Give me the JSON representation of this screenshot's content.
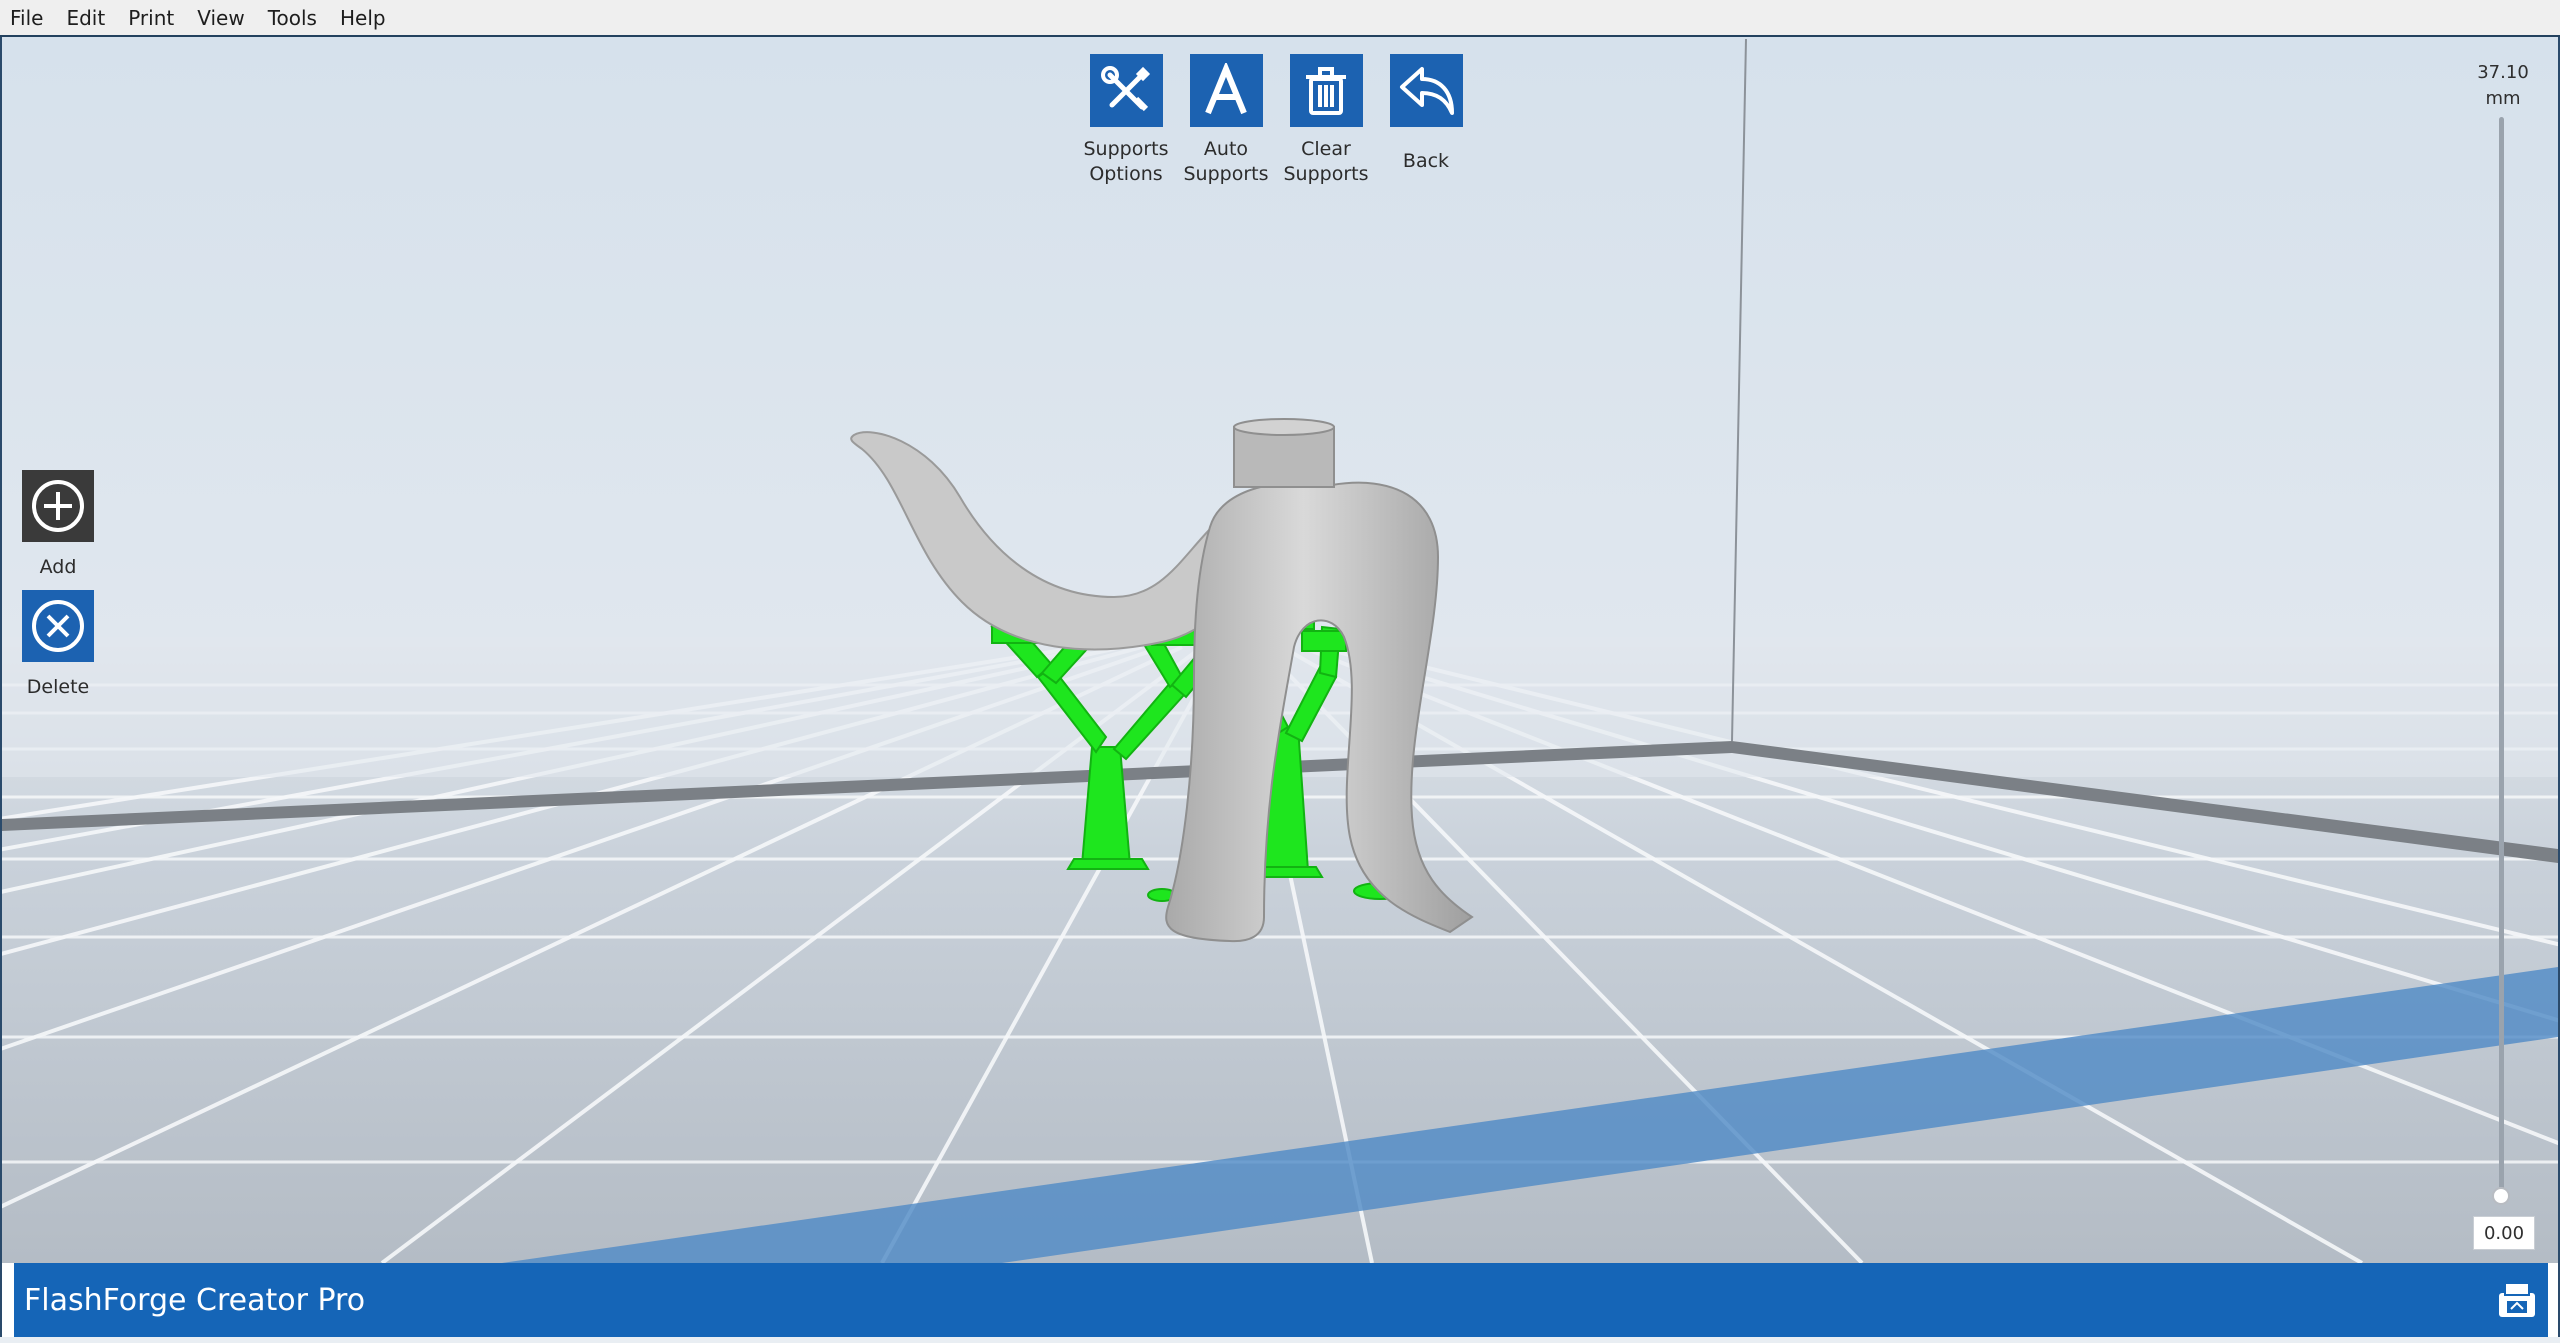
{
  "menu": [
    "File",
    "Edit",
    "Print",
    "View",
    "Tools",
    "Help"
  ],
  "toolbar": {
    "supports_options": "Supports\nOptions",
    "auto_supports": "Auto\nSupports",
    "clear_supports": "Clear\nSupports",
    "back": "Back"
  },
  "side": {
    "add": "Add",
    "delete": "Delete"
  },
  "height": {
    "top_value": "37.10",
    "unit": "mm",
    "current_value": "0.00",
    "level": 0
  },
  "status": {
    "printer_name": "FlashForge Creator Pro"
  },
  "colors": {
    "accent": "#1565b7",
    "icon_blue": "#1c62b1",
    "support_green": "#1ee61e",
    "model_gray": "#c9c9c9"
  },
  "icons": {
    "supports_options": "wrench-screwdriver-icon",
    "auto_supports": "letter-a-icon",
    "clear_supports": "trash-icon",
    "back": "undo-arrow-icon",
    "add": "plus-circle-icon",
    "delete": "x-circle-icon",
    "printer": "printer-icon"
  }
}
